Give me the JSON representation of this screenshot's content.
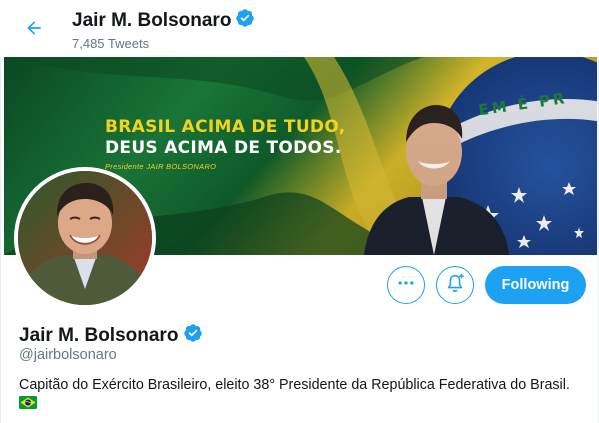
{
  "header": {
    "name": "Jair M. Bolsonaro",
    "tweet_count": "7,485 Tweets"
  },
  "banner": {
    "line1": "BRASIL ACIMA DE TUDO,",
    "line2": "DEUS ACIMA DE TODOS.",
    "caption": "Presidente JAIR BOLSONARO",
    "globe_text": "EM É PR"
  },
  "actions": {
    "following_label": "Following"
  },
  "profile": {
    "name": "Jair M. Bolsonaro",
    "handle": "@jairbolsonaro",
    "bio": "Capitão do Exército Brasileiro, eleito 38° Presidente da República Federativa do Brasil."
  },
  "colors": {
    "accent": "#1da1f2",
    "text_primary": "#14171a",
    "text_secondary": "#657786",
    "flag_green": "#009c3b",
    "flag_yellow": "#ffdf00",
    "flag_blue": "#002776"
  },
  "icons": [
    "back-arrow-icon",
    "verified-badge-icon",
    "more-dots-icon",
    "bell-plus-icon",
    "brazil-flag-icon"
  ]
}
